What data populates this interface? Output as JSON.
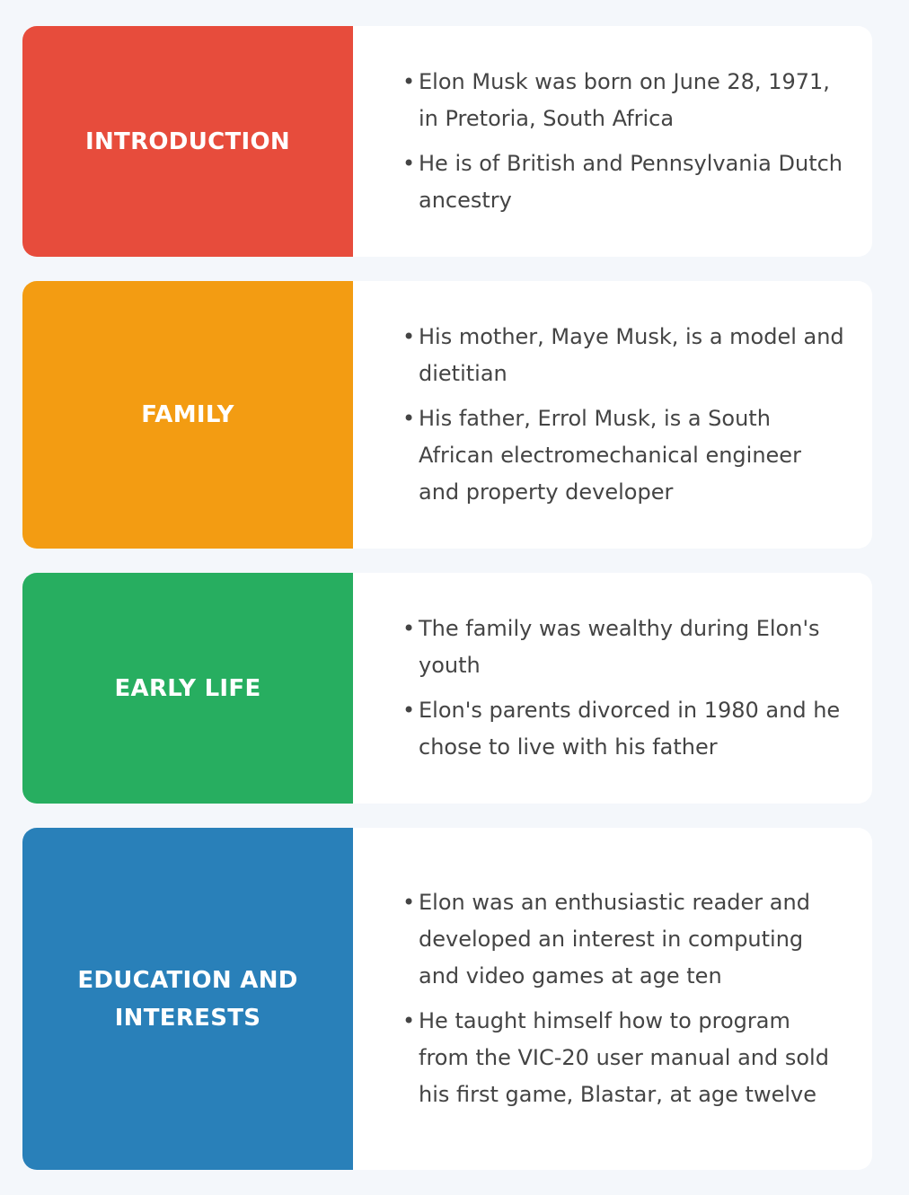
{
  "sections": [
    {
      "title": "INTRODUCTION",
      "color": "#e74c3c",
      "bullets": [
        "Elon Musk was born on June 28, 1971, in Pretoria, South Africa",
        "He is of British and Pennsylvania Dutch ancestry"
      ]
    },
    {
      "title": "FAMILY",
      "color": "#f39c12",
      "bullets": [
        "His mother, Maye Musk, is a model and dietitian",
        "His father, Errol Musk, is a South African electromechanical engineer and property developer"
      ]
    },
    {
      "title": "EARLY LIFE",
      "color": "#27ae60",
      "bullets": [
        "The family was wealthy during Elon's youth",
        "Elon's parents divorced in 1980 and he chose to live with his father"
      ]
    },
    {
      "title": "EDUCATION AND\nINTERESTS",
      "color": "#2980b9",
      "bullets": [
        "Elon was an enthusiastic reader and developed an interest in computing and video games at age ten",
        "He taught himself how to program from the VIC-20 user manual and sold his first game, Blastar, at age twelve"
      ]
    }
  ]
}
